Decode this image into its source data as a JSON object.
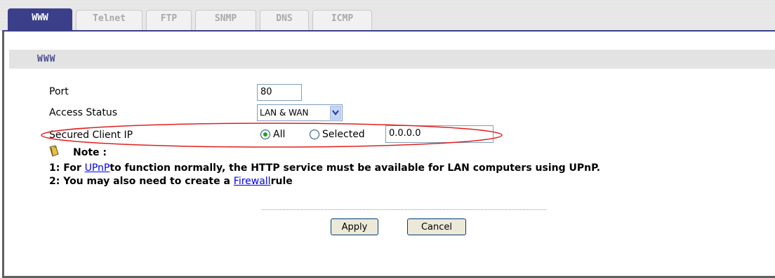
{
  "tabs": [
    {
      "label": "WWW",
      "active": true
    },
    {
      "label": "Telnet",
      "active": false
    },
    {
      "label": "FTP",
      "active": false
    },
    {
      "label": "SNMP",
      "active": false
    },
    {
      "label": "DNS",
      "active": false
    },
    {
      "label": "ICMP",
      "active": false
    }
  ],
  "section": {
    "title": "WWW"
  },
  "form": {
    "port_label": "Port",
    "port_value": "80",
    "access_label": "Access Status",
    "access_value": "LAN & WAN",
    "secured_label": "Secured Client IP",
    "radio_all_label": "All",
    "radio_selected_label": "Selected",
    "ip_value": "0.0.0.0"
  },
  "note": {
    "title": "Note :",
    "line1_prefix": "1: For ",
    "line1_link": "UPnP",
    "line1_rest": "to function normally, the HTTP service must be available for LAN computers using UPnP.",
    "line2_prefix": "2: You may also need to create a ",
    "line2_link": "Firewall",
    "line2_rest": "rule"
  },
  "buttons": {
    "apply": "Apply",
    "cancel": "Cancel"
  },
  "colors": {
    "active_tab": "#3b3f8a",
    "highlight_ellipse": "#e0201e",
    "radio_dot": "#21a121"
  },
  "icons": {
    "note": "note-book-icon",
    "dropdown": "chevron-down-icon"
  }
}
